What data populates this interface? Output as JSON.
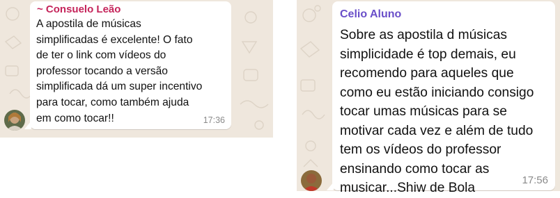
{
  "colors": {
    "chat_background": "#efe7dd",
    "bubble": "#ffffff",
    "sender_1": "#c5245a",
    "sender_2": "#6a4fc9",
    "timestamp": "#8a8a8a"
  },
  "messages": [
    {
      "sender": "~ Consuelo Leão",
      "text": "A apostila de músicas\nsimplificadas é excelente! O fato\nde ter o link com vídeos do\nprofessor tocando a versão\nsimplificada dá um super incentivo\npara tocar, como também ajuda\nem como tocar!!",
      "time": "17:36",
      "avatar_icon": "user-avatar"
    },
    {
      "sender": "Celio Aluno",
      "text": "Sobre as apostila d músicas\nsimplicidade é top demais, eu\nrecomendo para aqueles que\ncomo eu estão iniciando  consigo\ntocar umas músicas para se\nmotivar cada vez e além de tudo\ntem os vídeos do professor\nensinando como tocar as\nmusicar...Shiw de Bola",
      "time": "17:56",
      "avatar_icon": "user-avatar"
    }
  ]
}
